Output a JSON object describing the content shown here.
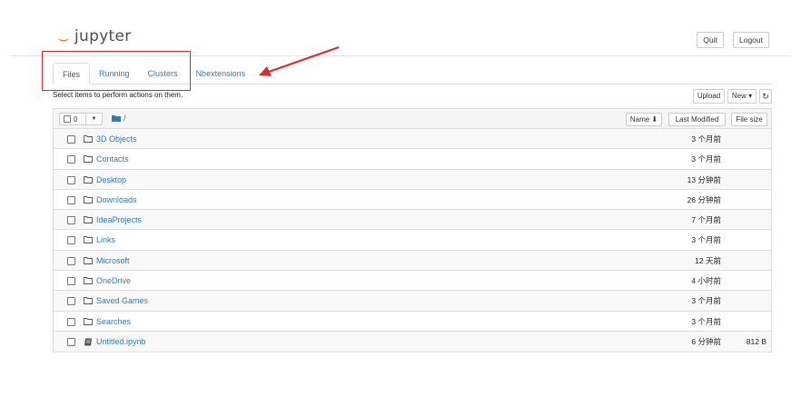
{
  "header": {
    "logo_text": "jupyter",
    "quit_label": "Quit",
    "logout_label": "Logout"
  },
  "tabs": [
    {
      "label": "Files",
      "active": true
    },
    {
      "label": "Running",
      "active": false
    },
    {
      "label": "Clusters",
      "active": false
    },
    {
      "label": "Nbextensions",
      "active": false
    }
  ],
  "toolbar": {
    "select_info": "Select items to perform actions on them.",
    "upload_label": "Upload",
    "new_label": "New ▾",
    "refresh_icon": "refresh-icon"
  },
  "list_header": {
    "selected_count": "0",
    "path": "/",
    "sort_name": "Name ⬇",
    "sort_modified": "Last Modified",
    "sort_size": "File size"
  },
  "items": [
    {
      "name": "3D Objects",
      "type": "folder",
      "modified": "3 个月前",
      "size": ""
    },
    {
      "name": "Contacts",
      "type": "folder",
      "modified": "3 个月前",
      "size": ""
    },
    {
      "name": "Desktop",
      "type": "folder",
      "modified": "13 分钟前",
      "size": ""
    },
    {
      "name": "Downloads",
      "type": "folder",
      "modified": "26 分钟前",
      "size": ""
    },
    {
      "name": "IdeaProjects",
      "type": "folder",
      "modified": "7 个月前",
      "size": ""
    },
    {
      "name": "Links",
      "type": "folder",
      "modified": "3 个月前",
      "size": ""
    },
    {
      "name": "Microsoft",
      "type": "folder",
      "modified": "12 天前",
      "size": ""
    },
    {
      "name": "OneDrive",
      "type": "folder",
      "modified": "4 小时前",
      "size": ""
    },
    {
      "name": "Saved Games",
      "type": "folder",
      "modified": "3 个月前",
      "size": ""
    },
    {
      "name": "Searches",
      "type": "folder",
      "modified": "3 个月前",
      "size": ""
    },
    {
      "name": "Untitled.ipynb",
      "type": "notebook",
      "modified": "6 分钟前",
      "size": "812 B"
    }
  ],
  "colors": {
    "link": "#337ab7",
    "annotation": "#e0292e",
    "logo_orange": "#f37726"
  }
}
